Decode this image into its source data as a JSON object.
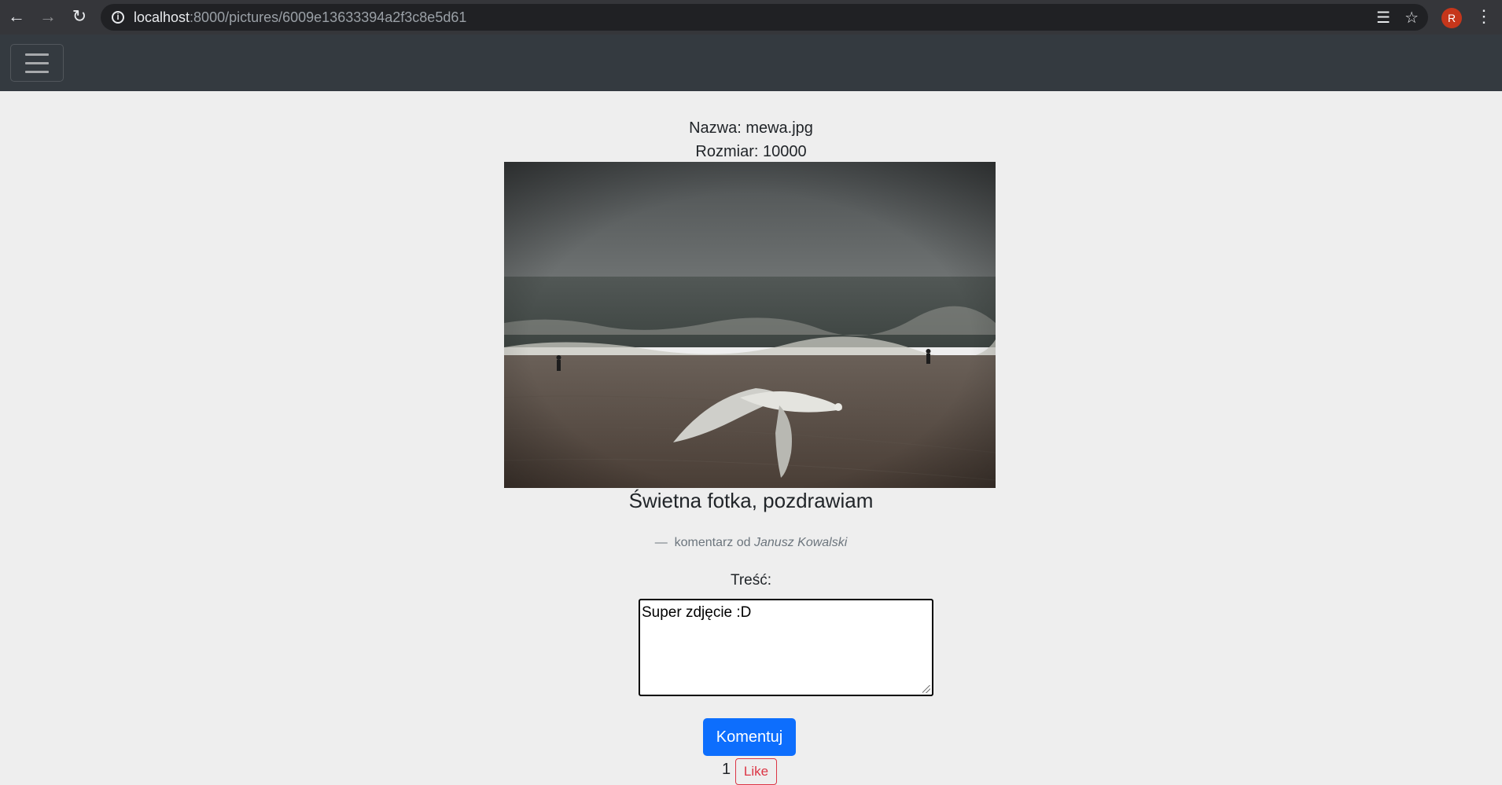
{
  "browser": {
    "url_host": "localhost",
    "url_path": ":8000/pictures/6009e13633394a2f3c8e5d61",
    "avatar_letter": "R",
    "icons": [
      "back-arrow-icon",
      "forward-arrow-icon",
      "reload-icon",
      "info-icon",
      "translate-icon",
      "star-icon",
      "menu-dots-icon"
    ]
  },
  "navbar": {
    "toggler_icon": "hamburger-icon",
    "background": "#343a40"
  },
  "picture": {
    "name_line": "Nazwa: mewa.jpg",
    "size_line": "Rozmiar: 10000",
    "image_description": "seagull-over-beach-photo"
  },
  "comment": {
    "text": "Świetna fotka, pozdrawiam",
    "dash": "—",
    "author_prefix": "komentarz od",
    "author_name": "Janusz Kowalski"
  },
  "form": {
    "label": "Treść:",
    "textarea_value": "Super zdjęcie :D",
    "submit_label": "Komentuj"
  },
  "likes": {
    "count": "1",
    "button_label": "Like"
  },
  "colors": {
    "primary": "#0d6efd",
    "danger": "#dc3545",
    "page_bg": "#eeeeee"
  }
}
